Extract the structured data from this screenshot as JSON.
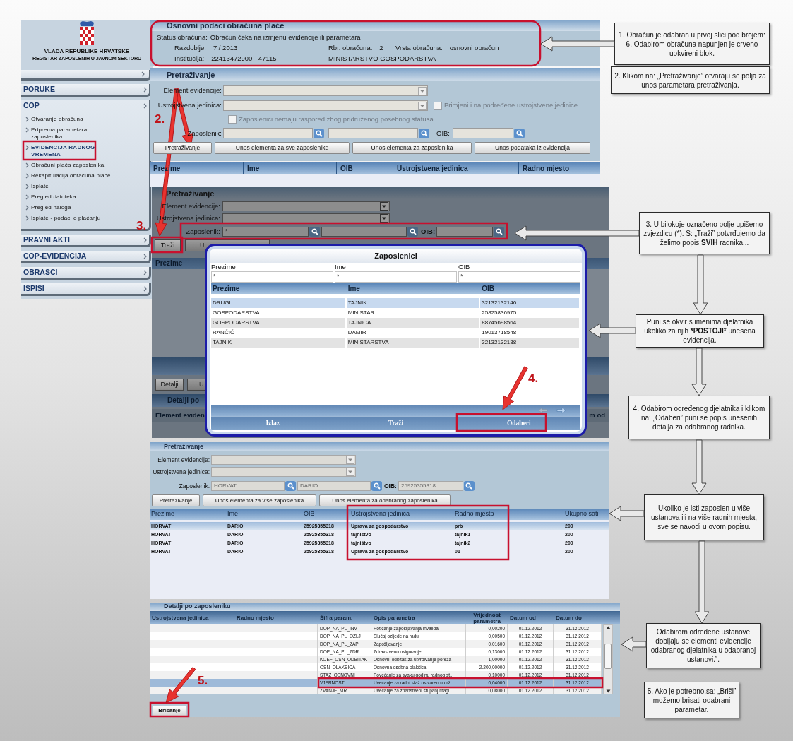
{
  "sidebar": {
    "title_lines": [
      "VLADA REPUBLIKE HRVATSKE",
      "REGISTAR ZAPOSLENIH U JAVNOM SEKTORU"
    ],
    "menu": [
      {
        "label": "PORUKE"
      },
      {
        "label": "COP",
        "expanded": true,
        "children": [
          {
            "label": "Otvaranje obračuna",
            "selected": false
          },
          {
            "label": "Priprema parametara\nzaposlenika",
            "selected": false
          },
          {
            "label": "EVIDENCIJA RADNOG\nVREMENA",
            "selected": true
          },
          {
            "label": "Obračuni plaća zaposlenika",
            "selected": false
          },
          {
            "label": "Rekapitulacija obračuna plaće",
            "selected": false
          },
          {
            "label": "Isplate",
            "selected": false
          },
          {
            "label": "Pregled datoteka",
            "selected": false
          },
          {
            "label": "Pregled naloga",
            "selected": false
          },
          {
            "label": "Isplate - podaci o plaćanju",
            "selected": false
          }
        ]
      },
      {
        "label": "PRAVNI AKTI"
      },
      {
        "label": "COP-EVIDENCIJA"
      },
      {
        "label": "OBRASCI"
      },
      {
        "label": "ISPISI"
      }
    ]
  },
  "summary": {
    "title": "Osnovni podaci obračuna plaće",
    "status_label": "Status obračuna:",
    "status_value": "Obračun čeka na izmjenu evidencije ili parametara",
    "rows": [
      [
        {
          "label": "Razdoblje:",
          "value": "7 / 2013"
        },
        {
          "label": "Rbr. obračuna:",
          "value": "2"
        },
        {
          "label": "Vrsta obračuna:",
          "value": "osnovni obračun"
        }
      ],
      [
        {
          "label": "Institucija:",
          "value": "22413472900 - 47115"
        },
        {
          "value": "MINISTARSTVO GOSPODARSTVA"
        }
      ]
    ]
  },
  "search_panel": {
    "title": "Pretraživanje",
    "element_label": "Element evidencije:",
    "unit_label": "Ustrojstvena jedinica:",
    "checkboxes": [
      {
        "label": "Primjeni i na podređene ustrojstvene jedinice",
        "checked": false
      },
      {
        "label": "Zaposlenici nemaju raspored zbog pridruženog posebnog statusa",
        "checked": false
      }
    ],
    "employee_label": "Zaposlenik:",
    "oib_label": "OIB:",
    "buttons": [
      "Pretraživanje",
      "Unos elementa za sve zaposlenike",
      "Unos elementa za zaposlenika",
      "Unos podataka iz evidencija"
    ],
    "columns": [
      "Prezime",
      "Ime",
      "OIB",
      "Ustrojstvena jedinica",
      "Radno mjesto"
    ]
  },
  "dark_panel": {
    "title": "Pretraživanje",
    "element_label": "Element evidencije:",
    "unit_label": "Ustrojstvena jedinica:",
    "employee_label": "Zaposlenik:",
    "employee_value": "*",
    "oib_label": "OIB:",
    "search_button": "Traži",
    "covered_button": "U",
    "column": "Prezime",
    "details_button": "Detalji",
    "details_covered_button": "U",
    "details_title": "Detalji po",
    "details_column": "Element eviden",
    "right_column": "m od"
  },
  "modal": {
    "title": "Zaposlenici",
    "filters": [
      {
        "label": "Prezime",
        "value": "*"
      },
      {
        "label": "Ime",
        "value": "*"
      },
      {
        "label": "OIB",
        "value": "*"
      }
    ],
    "columns": [
      "Prezime",
      "Ime",
      "OIB"
    ],
    "rows": [
      {
        "cells": [
          "DRUGI",
          "TAJNIK",
          "32132132146"
        ],
        "selected": true
      },
      {
        "cells": [
          "GOSPODARSTVA",
          "MINISTAR",
          "25825836975"
        ],
        "selected": false
      },
      {
        "cells": [
          "GOSPODARSTVA",
          "TAJNICA",
          "88745698564"
        ],
        "selected": false
      },
      {
        "cells": [
          "RANČIĆ",
          "DAMIR",
          "19013718548"
        ],
        "selected": false
      },
      {
        "cells": [
          "TAJNIK",
          "MINISTARSTVA",
          "32132132138"
        ],
        "selected": false
      }
    ],
    "buttons": [
      "Izlaz",
      "Traži",
      "Odaberi"
    ]
  },
  "result_panel": {
    "title": "Pretraživanje",
    "element_label": "Element evidencije:",
    "unit_label": "Ustrojstvena jedinica:",
    "employee_label": "Zaposlenik:",
    "surname": "HORVAT",
    "name": "DARIO",
    "oib_label": "OIB:",
    "oib": "25925355318",
    "buttons": [
      "Pretraživanje",
      "Unos elementa za više zaposlenika",
      "Unos elementa za odabranog zaposlenika"
    ],
    "columns": [
      "Prezime",
      "Ime",
      "OIB",
      "Ustrojstvena jedinica",
      "Radno mjesto",
      "Ukupno sati"
    ],
    "rows": [
      {
        "cells": [
          "HORVAT",
          "DARIO",
          "25925355318",
          "Uprava za gospodarstvo",
          "prb",
          "200"
        ],
        "selected": true
      },
      {
        "cells": [
          "HORVAT",
          "DARIO",
          "25925355318",
          "tajništvo",
          "tajnik1",
          "200"
        ],
        "selected": false
      },
      {
        "cells": [
          "HORVAT",
          "DARIO",
          "25925355318",
          "tajništvo",
          "tajnik2",
          "200"
        ],
        "selected": false
      },
      {
        "cells": [
          "HORVAT",
          "DARIO",
          "25925355318",
          "Uprava za gospodarstvo",
          "01",
          "200"
        ],
        "selected": false
      }
    ]
  },
  "details_panel": {
    "title": "Detalji po zaposleniku",
    "columns": [
      "Ustrojstvena jedinica",
      "Radno mjesto",
      "Šifra param.",
      "Opis parametra",
      "Vrijednost parametra",
      "Datum od",
      "Datum do"
    ],
    "rows": [
      {
        "cells": [
          "",
          "",
          "DOP_NA_PL_INV",
          "Poticanje zapošljavanja invalida",
          "0,00200",
          "01.12.2012",
          "31.12.2012"
        ],
        "selected": false
      },
      {
        "cells": [
          "",
          "",
          "DOP_NA_PL_OZLJ",
          "Slučaj ozljede na radu",
          "0,00500",
          "01.12.2012",
          "31.12.2012"
        ],
        "selected": false
      },
      {
        "cells": [
          "",
          "",
          "DOP_NA_PL_ZAP",
          "Zapošljavanje",
          "0,01600",
          "01.12.2012",
          "31.12.2012"
        ],
        "selected": false
      },
      {
        "cells": [
          "",
          "",
          "DOP_NA_PL_ZDR",
          "Zdravstveno osiguranje",
          "0,13000",
          "01.12.2012",
          "31.12.2012"
        ],
        "selected": false
      },
      {
        "cells": [
          "",
          "",
          "KOEF_OSN_ODBITAK",
          "Osnovni odbitak za utvrđivanje poreza",
          "1,00000",
          "01.12.2012",
          "31.12.2012"
        ],
        "selected": false
      },
      {
        "cells": [
          "",
          "",
          "OSN_OLAKSICA",
          "Osnovna osobna olakšica",
          "2.200,00000",
          "01.12.2012",
          "31.12.2012"
        ],
        "selected": false
      },
      {
        "cells": [
          "",
          "",
          "STAZ_OSNOVNI",
          "Povećanje za svaku godinu radnog st...",
          "0,10000",
          "01.12.2012",
          "31.12.2012"
        ],
        "selected": false
      },
      {
        "cells": [
          "",
          "",
          "VJERNOST",
          "Uvećanje za radni staž ostvaren u drž...",
          "0,04000",
          "01.12.2012",
          "31.12.2012"
        ],
        "selected": true
      },
      {
        "cells": [
          "",
          "",
          "ZVANJE_MR",
          "Uvećanje za znanstveni stupanj magi...",
          "0,08000",
          "01.12.2012",
          "31.12.2012"
        ],
        "selected": false
      }
    ],
    "button": "Brisanje"
  },
  "callouts": [
    "1. Obračun je odabran u prvoj slici pod brojem: 6. Odabirom obračuna napunjen je crveno uokvireni blok.",
    "2. Klikom na: „Pretraživanje” otvaraju se polja za unos parametara pretraživanja.",
    "3. U bilokoje označeno  polje upišemo zvjezdicu (*).  S: „Traži” potvrđujemo da želimo popis **SVIH** radnika...",
    "Puni se okvir s imenima djelatnika ukoliko za njih ***POSTOJI*** unesena evidencija.",
    "4. Odabirom određenog djelatnika i klikom na: „Odaberi” puni se popis unesenih detalja za odabranog radnika.",
    "Ukoliko je isti zaposlen u više ustanova ili na više radnih mjesta, sve se navodi u ovom popisu.",
    "Odabirom određene ustanove dobijaju se elementi evidencije odabranog djelatnika u odabranoj ustanovi.”.",
    "5.  Ako je potrebno,sa: „Briši” možemo brisati odabrani parametar."
  ],
  "step_numbers": [
    "2.",
    "3.",
    "4.",
    "5."
  ]
}
